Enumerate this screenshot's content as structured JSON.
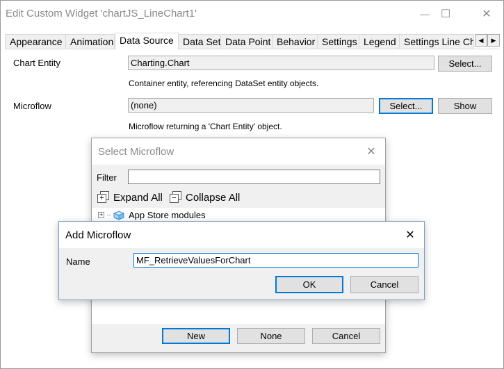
{
  "window": {
    "title": "Edit Custom Widget 'chartJS_LineChart1'",
    "minimize_glyph": "—",
    "maximize_glyph": "☐",
    "close_glyph": "✕"
  },
  "tabs": [
    {
      "label": "Appearance"
    },
    {
      "label": "Animation"
    },
    {
      "label": "Data Source"
    },
    {
      "label": "Data Set"
    },
    {
      "label": "Data Point"
    },
    {
      "label": "Behavior"
    },
    {
      "label": "Settings"
    },
    {
      "label": "Legend"
    },
    {
      "label": "Settings Line Cha"
    }
  ],
  "active_tab": "Data Source",
  "tab_scroll": {
    "left": "◀",
    "right": "▶"
  },
  "form": {
    "chart_entity": {
      "label": "Chart Entity",
      "value": "Charting.Chart",
      "select_label": "Select...",
      "hint": "Container entity, referencing DataSet entity objects."
    },
    "microflow": {
      "label": "Microflow",
      "value": "(none)",
      "select_label": "Select...",
      "show_label": "Show",
      "hint": "Microflow returning a 'Chart Entity' object."
    }
  },
  "select_dialog": {
    "title": "Select Microflow",
    "close_glyph": "✕",
    "filter_label": "Filter",
    "filter_value": "",
    "expand_all": "Expand All",
    "collapse_all": "Collapse All",
    "tree": [
      {
        "label": "App Store modules",
        "expander": "+"
      }
    ],
    "buttons": {
      "new": "New",
      "none": "None",
      "cancel": "Cancel"
    }
  },
  "add_dialog": {
    "title": "Add Microflow",
    "close_glyph": "✕",
    "name_label": "Name",
    "name_value": "MF_RetrieveValuesForChart",
    "ok": "OK",
    "cancel": "Cancel"
  },
  "colors": {
    "focus_blue": "#0078d7",
    "dialog_bg": "#f0f0f0",
    "button_bg": "#e1e1e1",
    "title_grey": "#8a8a8a"
  },
  "icons": {
    "window_close": "close-icon",
    "window_minimize": "minimize-icon",
    "window_maximize": "maximize-icon",
    "expand_all": "expand-all-icon",
    "collapse_all": "collapse-all-icon",
    "tree_module": "module-box-icon"
  }
}
